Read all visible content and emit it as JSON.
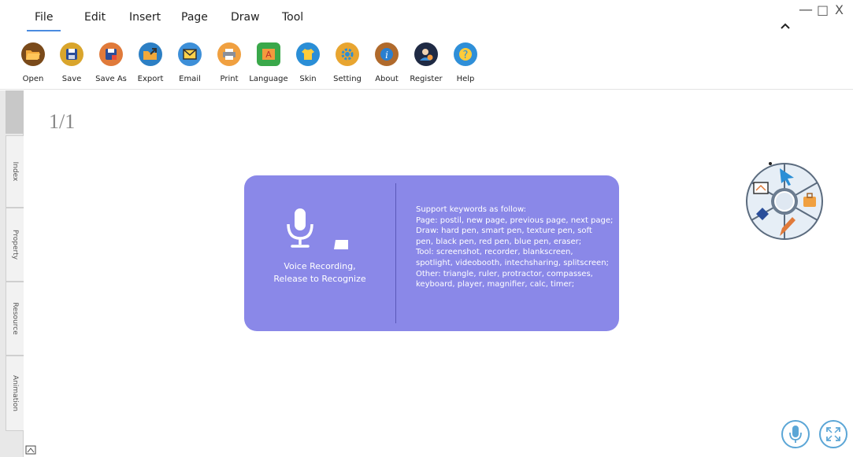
{
  "menu": {
    "tabs": [
      "File",
      "Edit",
      "Insert",
      "Page",
      "Draw",
      "Tool"
    ],
    "active_tab": "File"
  },
  "window_controls": {
    "minimize": "—",
    "restore": "□",
    "close": "X",
    "collapse": "^"
  },
  "toolbar": {
    "items": [
      {
        "label": "Open",
        "icon": "folder-open-icon",
        "color": "#7a4a1a"
      },
      {
        "label": "Save",
        "icon": "save-icon",
        "color": "#d9a52c"
      },
      {
        "label": "Save As",
        "icon": "save-as-icon",
        "color": "#e07a3a"
      },
      {
        "label": "Export",
        "icon": "export-icon",
        "color": "#2c7fc4"
      },
      {
        "label": "Email",
        "icon": "email-icon",
        "color": "#3d8fd8"
      },
      {
        "label": "Print",
        "icon": "print-icon",
        "color": "#f0a040"
      },
      {
        "label": "Language",
        "icon": "language-icon",
        "color": "#3aa84a"
      },
      {
        "label": "Skin",
        "icon": "skin-icon",
        "color": "#2a8ed6"
      },
      {
        "label": "Setting",
        "icon": "gear-icon",
        "color": "#e8a530"
      },
      {
        "label": "About",
        "icon": "info-icon",
        "color": "#b06a2c"
      },
      {
        "label": "Register",
        "icon": "register-icon",
        "color": "#1f2a44"
      },
      {
        "label": "Help",
        "icon": "help-icon",
        "color": "#2f8fd8"
      }
    ]
  },
  "sidebar": {
    "tabs": [
      "Index",
      "Property",
      "Resource",
      "Animation"
    ]
  },
  "page": {
    "indicator": "1/1"
  },
  "voice_panel": {
    "hint_line1": "Voice Recording,",
    "hint_line2": "Release to Recognize",
    "keyword_lines": [
      "Support keywords as follow:",
      "Page: postil, new page, previous page, next page;",
      "Draw: hard pen, smart pen, texture pen, soft",
      "pen, black pen, red pen, blue pen, eraser;",
      "Tool: screenshot, recorder, blankscreen,",
      "spotlight, videobooth, intechsharing, splitscreen;",
      "Other: triangle, ruler, protractor, compasses,",
      "keyboard, player, magnifier, calc, timer;"
    ],
    "color": "#8a88e8"
  },
  "radial_menu": {
    "icons": [
      "cursor-arrow-icon",
      "toolbox-icon",
      "pen-icon",
      "eraser-icon",
      "whiteboard-icon",
      "magnifier-icon"
    ]
  },
  "bottom": {
    "mic_icon": "microphone-icon",
    "fullscreen_icon": "fullscreen-icon"
  }
}
